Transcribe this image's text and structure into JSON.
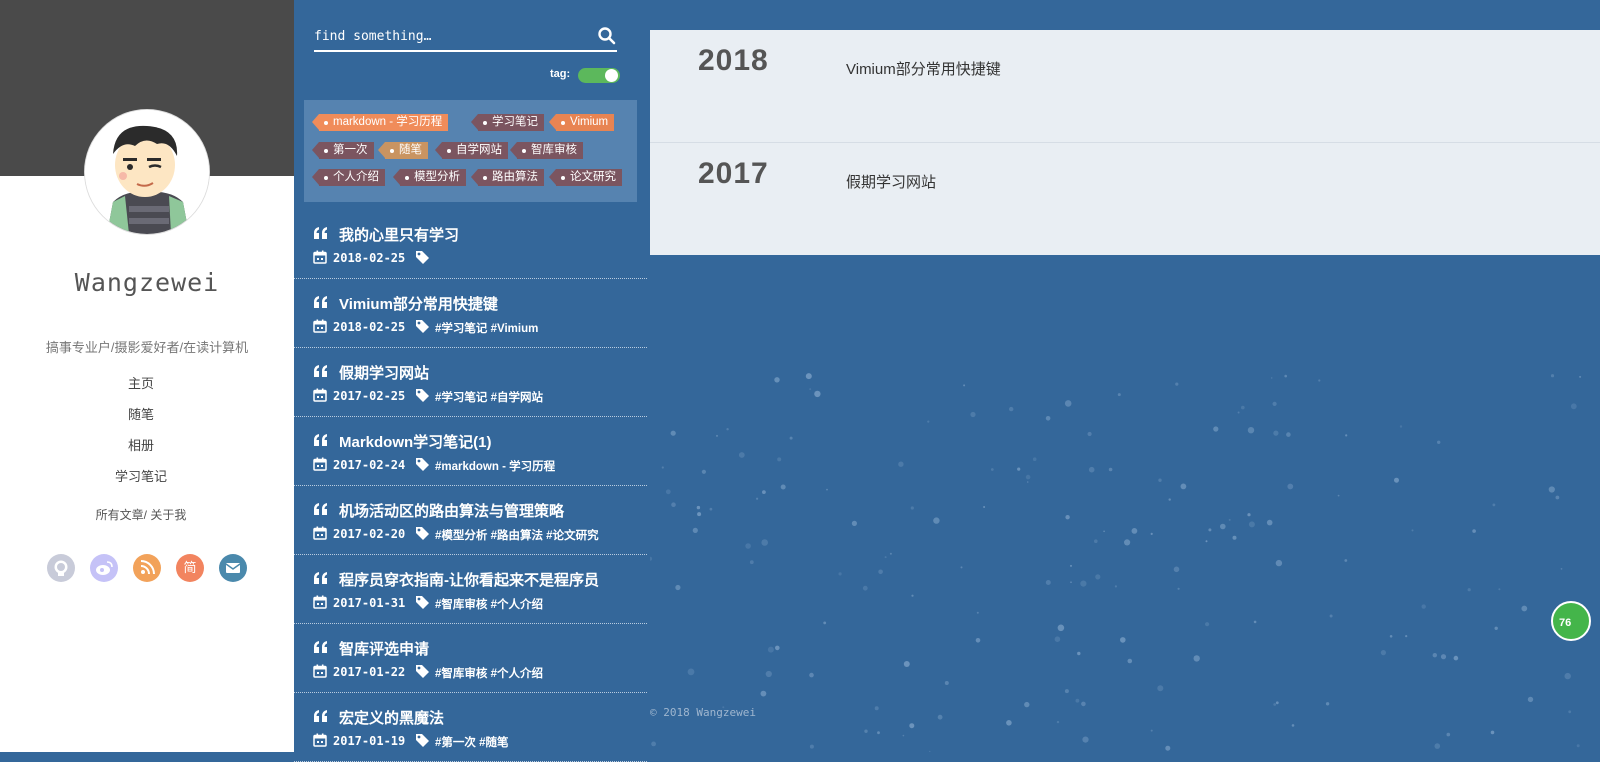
{
  "sidebar": {
    "author_name": "Wangzewei",
    "bio": "搞事专业户/摄影爱好者/在读计算机",
    "nav": [
      "主页",
      "随笔",
      "相册",
      "学习笔记"
    ],
    "all_posts": "所有文章/",
    "about_me": "关于我",
    "socials": [
      {
        "icon": "github-icon",
        "color": "#c8cbd9"
      },
      {
        "icon": "weibo-icon",
        "color": "#c5c2f7"
      },
      {
        "icon": "rss-icon",
        "color": "#f2a25a"
      },
      {
        "icon": "jianshu-icon",
        "label": "简",
        "color": "#f2845f"
      },
      {
        "icon": "mail-icon",
        "color": "#4a89ac"
      }
    ]
  },
  "search": {
    "placeholder": "find something…"
  },
  "tag_toggle": {
    "label": "tag:",
    "on": true
  },
  "tags": [
    {
      "label": "markdown - 学习历程",
      "color": "#f08c5a"
    },
    {
      "label": "学习笔记",
      "color": "#7b5560"
    },
    {
      "label": "Vimium",
      "color": "#e88452"
    },
    {
      "label": "第一次",
      "color": "#7b5560"
    },
    {
      "label": "随笔",
      "color": "#c99461"
    },
    {
      "label": "自学网站",
      "color": "#7b5560"
    },
    {
      "label": "智库审核",
      "color": "#7b5560"
    },
    {
      "label": "个人介绍",
      "color": "#7b5560"
    },
    {
      "label": "模型分析",
      "color": "#7b5560"
    },
    {
      "label": "路由算法",
      "color": "#7b5560"
    },
    {
      "label": "论文研究",
      "color": "#7b5560"
    }
  ],
  "posts": [
    {
      "title": "我的心里只有学习",
      "date": "2018-02-25",
      "tags": ""
    },
    {
      "title": "Vimium部分常用快捷键",
      "date": "2018-02-25",
      "tags": "#学习笔记 #Vimium"
    },
    {
      "title": "假期学习网站",
      "date": "2017-02-25",
      "tags": "#学习笔记 #自学网站"
    },
    {
      "title": "Markdown学习笔记(1)",
      "date": "2017-02-24",
      "tags": "#markdown - 学习历程"
    },
    {
      "title": "机场活动区的路由算法与管理策略",
      "date": "2017-02-20",
      "tags": "#模型分析 #路由算法 #论文研究"
    },
    {
      "title": "程序员穿衣指南-让你看起来不是程序员",
      "date": "2017-01-31",
      "tags": "#智库审核 #个人介绍"
    },
    {
      "title": "智库评选申请",
      "date": "2017-01-22",
      "tags": "#智库审核 #个人介绍"
    },
    {
      "title": "宏定义的黑魔法",
      "date": "2017-01-19",
      "tags": "#第一次 #随笔"
    }
  ],
  "archive": [
    {
      "year": "2018",
      "title": "Vimium部分常用快捷键"
    },
    {
      "year": "2017",
      "title": "假期学习网站"
    }
  ],
  "footer": "© 2018 Wangzewei",
  "badge": "76"
}
